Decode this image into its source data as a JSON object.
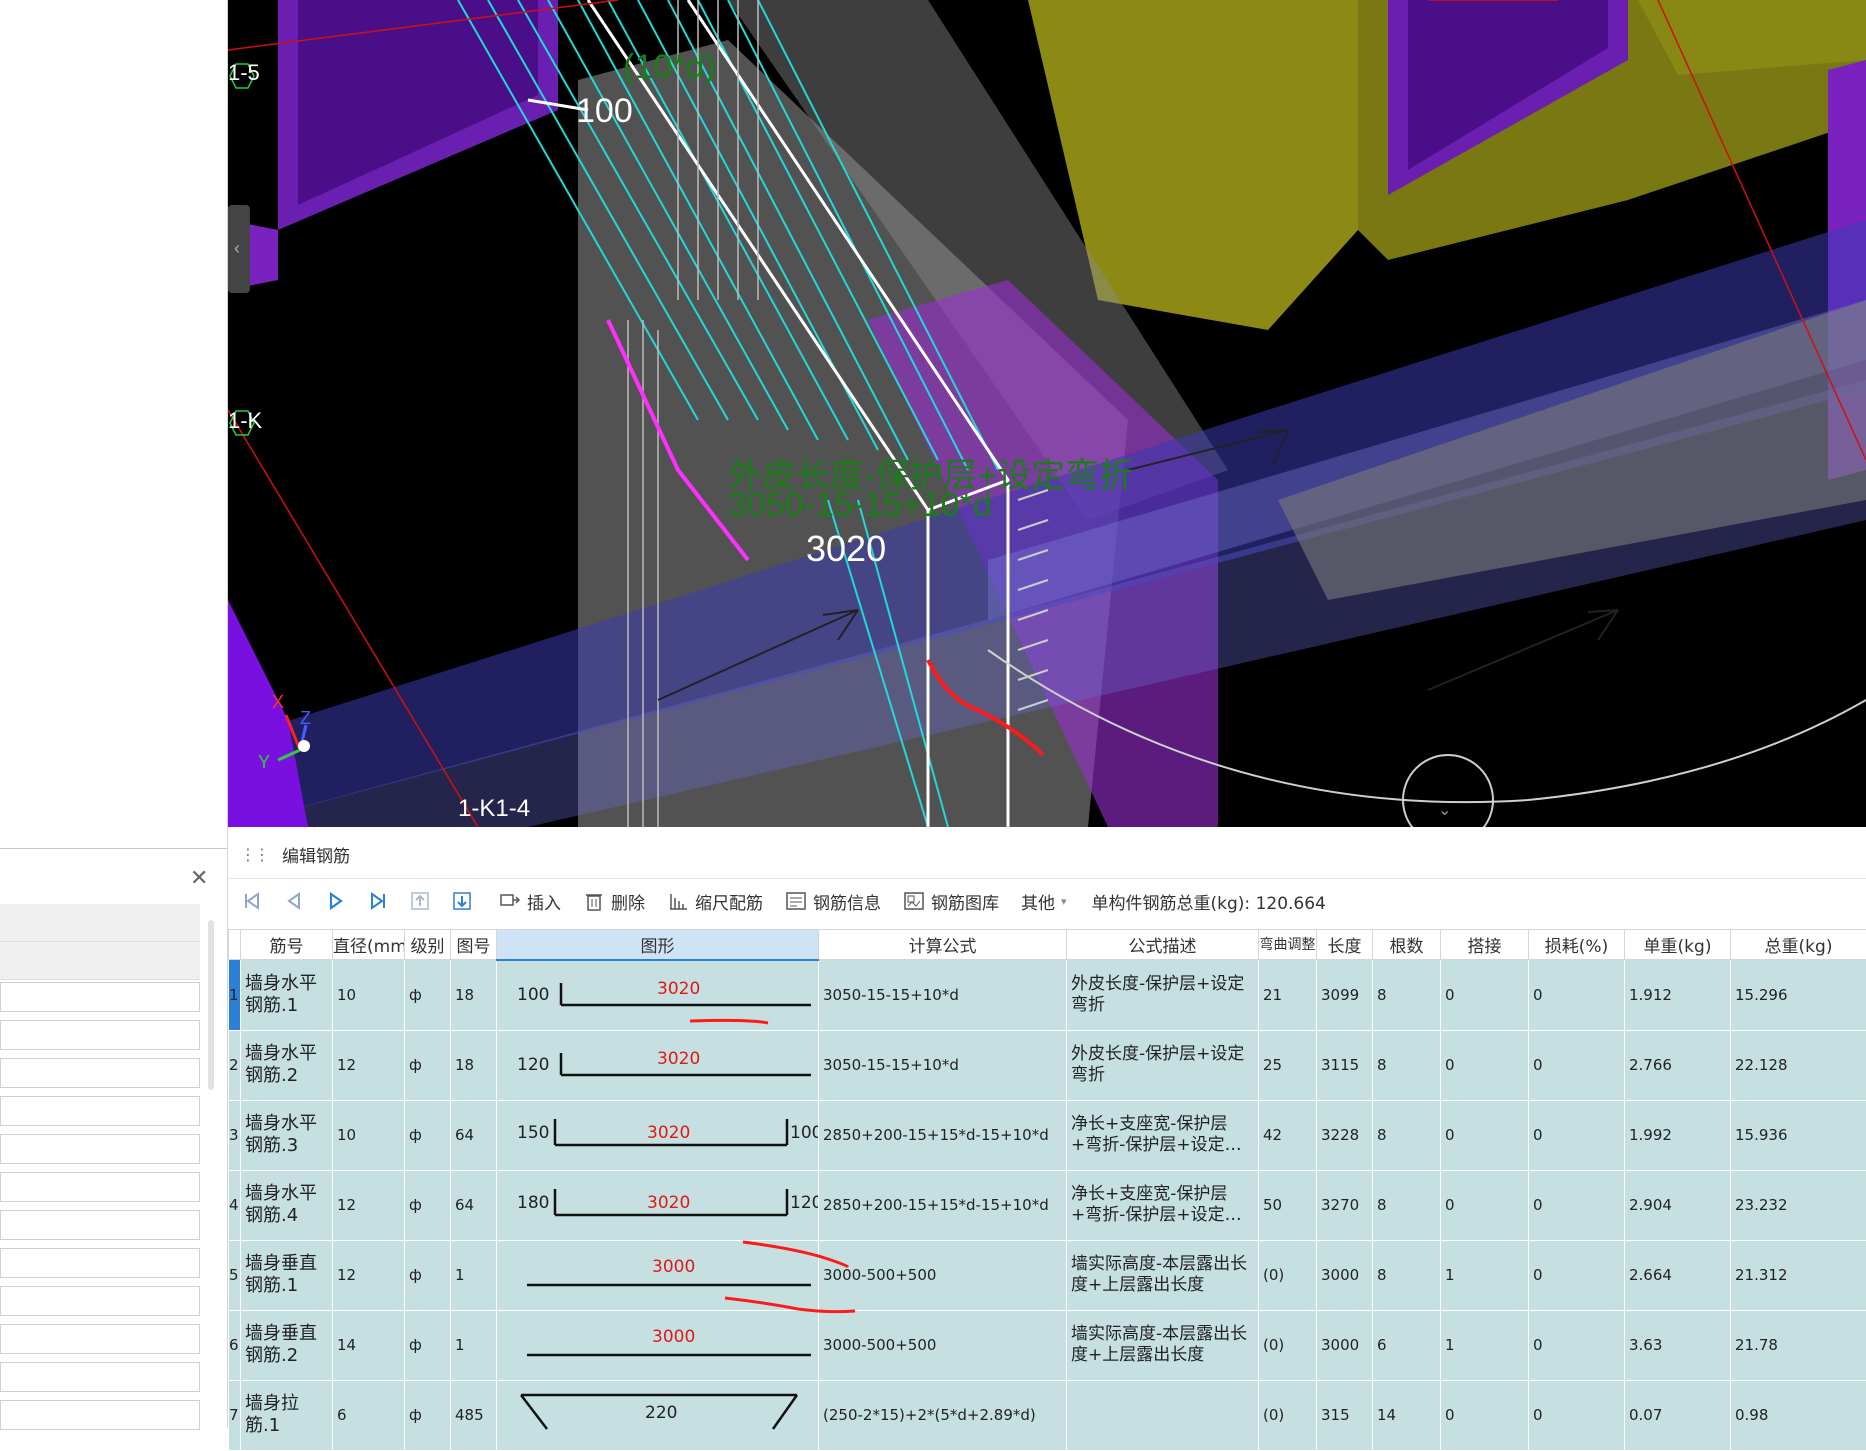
{
  "viewport": {
    "axis_labels": [
      "1-5",
      "1-K",
      "1-K1-4"
    ],
    "dim_top": "100",
    "dim_top_formula": "(10*d)",
    "dim_mid": "3020",
    "formula_text": "外皮长度-保护层+设定弯折",
    "formula_calc": "3050-15-15+10*d",
    "coord_axes": [
      "X",
      "Y",
      "Z"
    ]
  },
  "panel": {
    "title": "编辑钢筋",
    "toolbar": {
      "insert": "插入",
      "delete": "删除",
      "scale": "缩尺配筋",
      "info": "钢筋信息",
      "library": "钢筋图库",
      "other": "其他",
      "total_weight": "单构件钢筋总重(kg): 120.664"
    },
    "columns": [
      "筋号",
      "直径(mm)",
      "级别",
      "图号",
      "图形",
      "计算公式",
      "公式描述",
      "弯曲调整",
      "长度",
      "根数",
      "搭接",
      "损耗(%)",
      "单重(kg)",
      "总重(kg)"
    ]
  },
  "rows": [
    {
      "idx": "1",
      "name": "墙身水平钢筋.1",
      "dia": "10",
      "grade": "ф",
      "fig": "18",
      "shape_left": "100",
      "shape_mid": "3020",
      "shape_right": "",
      "shape_type": "L",
      "formula": "3050-15-15+10*d",
      "desc": "外皮长度-保护层+设定弯折",
      "bend": "21",
      "length": "3099",
      "count": "8",
      "lap": "0",
      "loss": "0",
      "unit_w": "1.912",
      "total_w": "15.296"
    },
    {
      "idx": "2",
      "name": "墙身水平钢筋.2",
      "dia": "12",
      "grade": "ф",
      "fig": "18",
      "shape_left": "120",
      "shape_mid": "3020",
      "shape_right": "",
      "shape_type": "L",
      "formula": "3050-15-15+10*d",
      "desc": "外皮长度-保护层+设定弯折",
      "bend": "25",
      "length": "3115",
      "count": "8",
      "lap": "0",
      "loss": "0",
      "unit_w": "2.766",
      "total_w": "22.128"
    },
    {
      "idx": "3",
      "name": "墙身水平钢筋.3",
      "dia": "10",
      "grade": "ф",
      "fig": "64",
      "shape_left": "150",
      "shape_mid": "3020",
      "shape_right": "100",
      "shape_type": "U",
      "formula": "2850+200-15+15*d-15+10*d",
      "desc": "净长+支座宽-保护层+弯折-保护层+设定…",
      "bend": "42",
      "length": "3228",
      "count": "8",
      "lap": "0",
      "loss": "0",
      "unit_w": "1.992",
      "total_w": "15.936"
    },
    {
      "idx": "4",
      "name": "墙身水平钢筋.4",
      "dia": "12",
      "grade": "ф",
      "fig": "64",
      "shape_left": "180",
      "shape_mid": "3020",
      "shape_right": "120",
      "shape_type": "U",
      "formula": "2850+200-15+15*d-15+10*d",
      "desc": "净长+支座宽-保护层+弯折-保护层+设定…",
      "bend": "50",
      "length": "3270",
      "count": "8",
      "lap": "0",
      "loss": "0",
      "unit_w": "2.904",
      "total_w": "23.232"
    },
    {
      "idx": "5",
      "name": "墙身垂直钢筋.1",
      "dia": "12",
      "grade": "ф",
      "fig": "1",
      "shape_left": "",
      "shape_mid": "3000",
      "shape_right": "",
      "shape_type": "I",
      "formula": "3000-500+500",
      "desc": "墙实际高度-本层露出长度+上层露出长度",
      "bend": "(0)",
      "length": "3000",
      "count": "8",
      "lap": "1",
      "loss": "0",
      "unit_w": "2.664",
      "total_w": "21.312"
    },
    {
      "idx": "6",
      "name": "墙身垂直钢筋.2",
      "dia": "14",
      "grade": "ф",
      "fig": "1",
      "shape_left": "",
      "shape_mid": "3000",
      "shape_right": "",
      "shape_type": "I",
      "formula": "3000-500+500",
      "desc": "墙实际高度-本层露出长度+上层露出长度",
      "bend": "(0)",
      "length": "3000",
      "count": "6",
      "lap": "1",
      "loss": "0",
      "unit_w": "3.63",
      "total_w": "21.78"
    },
    {
      "idx": "7",
      "name": "墙身拉筋.1",
      "dia": "6",
      "grade": "ф",
      "fig": "485",
      "shape_left": "",
      "shape_mid": "220",
      "shape_right": "",
      "shape_type": "hook",
      "formula": "(250-2*15)+2*(5*d+2.89*d)",
      "desc": "",
      "bend": "(0)",
      "length": "315",
      "count": "14",
      "lap": "0",
      "loss": "0",
      "unit_w": "0.07",
      "total_w": "0.98"
    }
  ],
  "colors": {
    "row_bg": "#c6e0e2",
    "accent": "#2e7fd6",
    "shape_red": "#e01818"
  }
}
